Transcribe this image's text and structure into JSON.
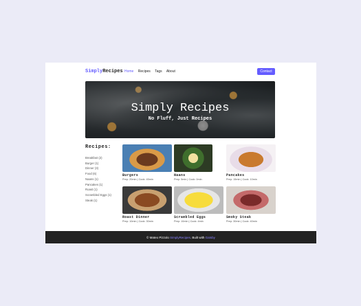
{
  "nav": {
    "logo_part1": "Simply",
    "logo_part2": "Recipes",
    "links": [
      "Home",
      "Recipes",
      "Tags",
      "About"
    ],
    "contact": "Contact"
  },
  "hero": {
    "title": "Simply Recipes",
    "subtitle": "No Fluff, Just Recipes"
  },
  "sidebar": {
    "title": "Recipes:",
    "tags": [
      "Breakfast (2)",
      "Burger (1)",
      "Dinner (3)",
      "Food (6)",
      "Naans (1)",
      "Pancakes (1)",
      "Roast (1)",
      "Scrambled Eggs (1)",
      "Steak (1)"
    ]
  },
  "recipes": [
    {
      "name": "Burgers",
      "meta": "Prep: 20min | Cook: 45min"
    },
    {
      "name": "Naans",
      "meta": "Prep: 5min | Cook: 0min"
    },
    {
      "name": "Pancakes",
      "meta": "Prep: 15min | Cook: 10min"
    },
    {
      "name": "Roast Dinner",
      "meta": "Prep: 10min | Cook: 30min"
    },
    {
      "name": "Scrambled Eggs",
      "meta": "Prep: 10min | Cook: 4min"
    },
    {
      "name": "Smoky Steak",
      "meta": "Prep: 30min | Cook: 40min"
    }
  ],
  "footer": {
    "copyright": "© Mateo Pizzolo ",
    "site": "SimplyRecipes",
    "built": ". Built with ",
    "framework": "Gatsby"
  }
}
